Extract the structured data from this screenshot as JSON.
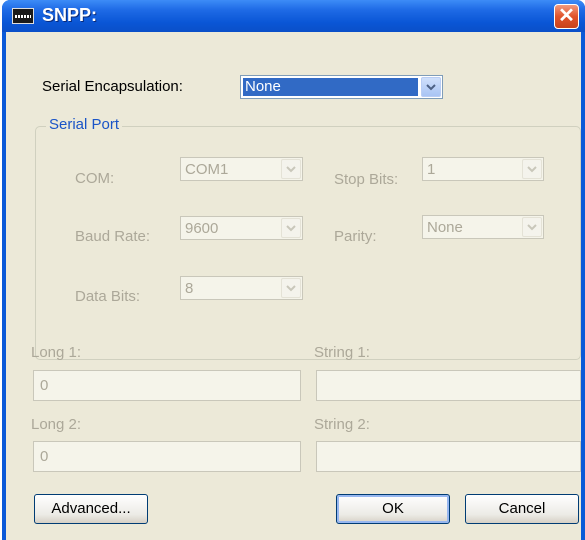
{
  "window": {
    "title": "SNPP:"
  },
  "serial_encapsulation": {
    "label": "Serial Encapsulation:",
    "value": "None"
  },
  "serial_port": {
    "title": "Serial Port",
    "com": {
      "label": "COM:",
      "value": "COM1"
    },
    "stop_bits": {
      "label": "Stop Bits:",
      "value": "1"
    },
    "baud_rate": {
      "label": "Baud Rate:",
      "value": "9600"
    },
    "parity": {
      "label": "Parity:",
      "value": "None"
    },
    "data_bits": {
      "label": "Data Bits:",
      "value": "8"
    }
  },
  "fields": {
    "long1": {
      "label": "Long 1:",
      "value": "0"
    },
    "string1": {
      "label": "String 1:",
      "value": ""
    },
    "long2": {
      "label": "Long 2:",
      "value": "0"
    },
    "string2": {
      "label": "String 2:",
      "value": ""
    }
  },
  "buttons": {
    "advanced": "Advanced...",
    "ok": "OK",
    "cancel": "Cancel"
  },
  "colors": {
    "titlebar": "#0a56d6",
    "dialog_bg": "#ece9d8",
    "group_title": "#1a54c7",
    "selection": "#316ac5"
  }
}
